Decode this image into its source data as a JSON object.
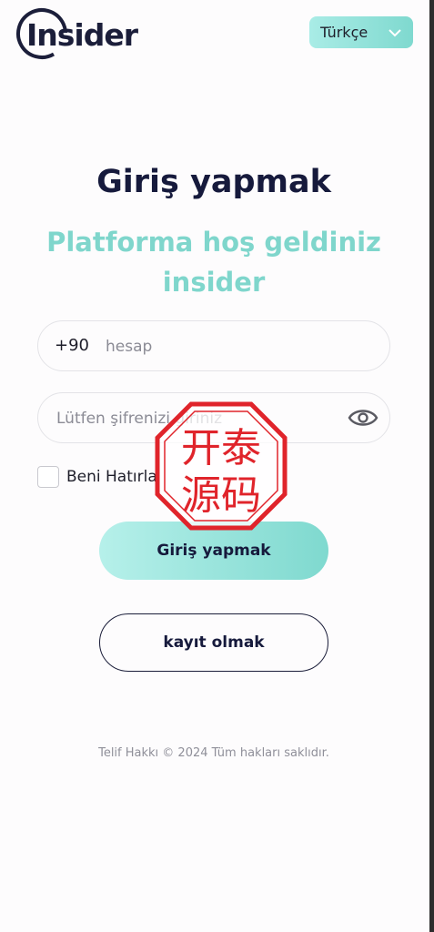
{
  "header": {
    "logo_text": "Insider",
    "language": {
      "selected": "Türkçe"
    }
  },
  "title": "Giriş yapmak",
  "subtitle": "Platforma hoş geldiniz insider",
  "form": {
    "phone_prefix": "+90",
    "account_placeholder": "hesap",
    "password_placeholder": "Lütfen şifrenizi giriniz",
    "remember_label": "Beni Hatırla"
  },
  "buttons": {
    "login": "Giriş yapmak",
    "register": "kayıt olmak"
  },
  "footer": "Telif Hakkı © 2024 Tüm hakları saklıdır.",
  "watermark": {
    "text": "开泰源码"
  },
  "colors": {
    "accent": "#7fd6cc",
    "title": "#161a3c",
    "stamp": "#e0242b"
  }
}
